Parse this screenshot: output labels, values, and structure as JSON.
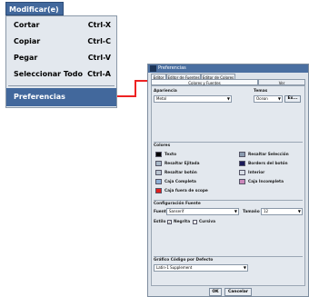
{
  "menu": {
    "title": "Modificar(e)",
    "items": [
      {
        "label": "Cortar",
        "shortcut": "Ctrl-X"
      },
      {
        "label": "Copiar",
        "shortcut": "Ctrl-C"
      },
      {
        "label": "Pegar",
        "shortcut": "Ctrl-V"
      },
      {
        "label": "Seleccionar Todo",
        "shortcut": "Ctrl-A"
      },
      {
        "label": "Preferencias",
        "shortcut": ""
      }
    ]
  },
  "dialog": {
    "title": "Preferencias",
    "tabs_row1": [
      "Editor",
      "Editor de Fuentes",
      "Editor de Colores"
    ],
    "tabs_row2": [
      "Colores y Fuentes",
      "Ver"
    ],
    "apariencia_label": "Apariencia",
    "apariencia_value": "Metal",
    "temas_label": "Temas",
    "temas_value": "Ocean",
    "temas_button": "Ex...",
    "colores_label": "Colores",
    "colores": [
      {
        "label": "Texto",
        "color": "#000000"
      },
      {
        "label": "Resaltar Selección",
        "color": "#8a9bb0"
      },
      {
        "label": "Resaltar Ejitada",
        "color": "#a8b8c8"
      },
      {
        "label": "Borders del botón",
        "color": "#1a1a5a"
      },
      {
        "label": "Resaltar botón",
        "color": "#b8c4d0"
      },
      {
        "label": "Interior",
        "color": "#d8dee6"
      },
      {
        "label": "Caja Completa",
        "color": "#8fb0d6"
      },
      {
        "label": "Caja Incompleta",
        "color": "#cc88bb"
      },
      {
        "label": "Caja fuera de scope",
        "color": "#e02020"
      }
    ],
    "fuente_group_label": "Configuración Fuente",
    "fuente_label": "Fuente",
    "fuente_value": "Sanserif",
    "tamano_label": "Tamaño",
    "tamano_value": "12",
    "estilo_label": "Estilo",
    "negrita_label": "Negrita",
    "negrita_checked": true,
    "cursiva_label": "Cursiva",
    "cursiva_checked": false,
    "grafico_label": "Gráfico Código por Defecto",
    "grafico_value": "Latin-1 Supplement",
    "ok_label": "OK",
    "cancel_label": "Cancelar"
  }
}
